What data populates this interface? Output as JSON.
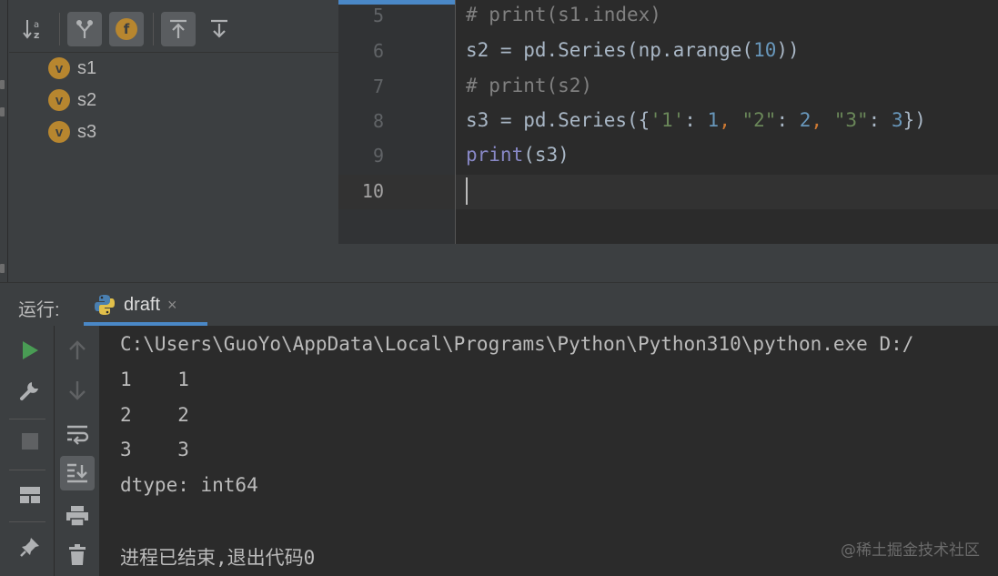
{
  "structure": {
    "toolbar": {
      "sort_alpha_icon": "sort-alphabetically-icon",
      "show_inherited_icon": "show-inherited-icon",
      "show_fields_icon": "show-fields-icon",
      "expand_icon": "expand-all-icon",
      "collapse_icon": "collapse-all-icon",
      "fields_badge": "f"
    },
    "items": [
      {
        "badge": "v",
        "label": "s1"
      },
      {
        "badge": "v",
        "label": "s2"
      },
      {
        "badge": "v",
        "label": "s3"
      }
    ]
  },
  "editor": {
    "lines": [
      {
        "number": "5",
        "text": "# print(s1.index)"
      },
      {
        "number": "6",
        "text": "s2 = pd.Series(np.arange(10))"
      },
      {
        "number": "7",
        "text": "# print(s2)"
      },
      {
        "number": "8",
        "text": "s3 = pd.Series({'1': 1, \"2\": 2, \"3\": 3})"
      },
      {
        "number": "9",
        "text": "print(s3)"
      },
      {
        "number": "10",
        "text": ""
      }
    ],
    "colors": {
      "comment": "#808080",
      "number": "#6897bb",
      "string": "#6a8759",
      "builtin": "#8888c6",
      "default": "#a9b7c6"
    }
  },
  "run": {
    "label": "运行:",
    "tab": {
      "title": "draft",
      "close": "×"
    },
    "console": [
      "C:\\Users\\GuoYo\\AppData\\Local\\Programs\\Python\\Python310\\python.exe D:/",
      "1    1",
      "2    2",
      "3    3",
      "dtype: int64",
      "",
      "进程已结束,退出代码0"
    ],
    "watermark": "@稀土掘金技术社区"
  },
  "accent_color": "#4a88c7",
  "run_green": "#499c54"
}
